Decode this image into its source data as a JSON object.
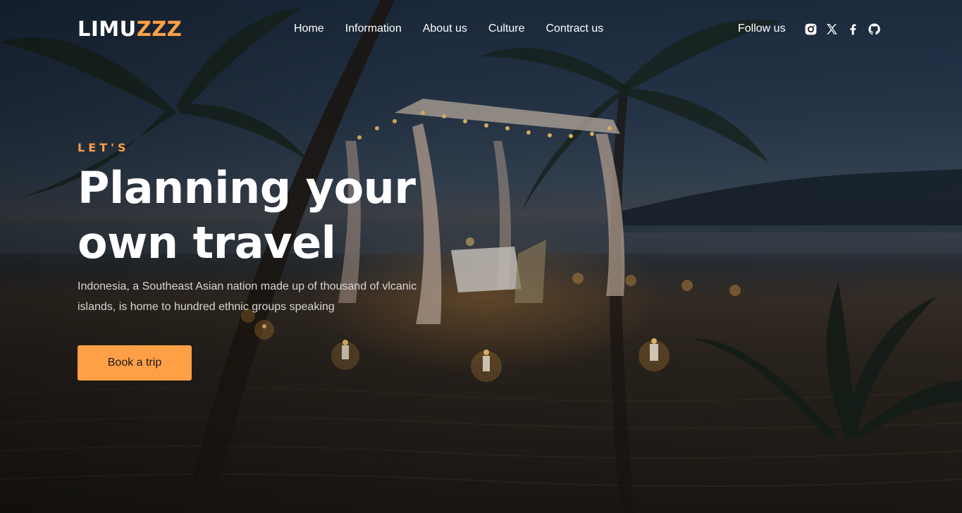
{
  "brand": {
    "logo_primary": "LIMU",
    "logo_accent": "ZZZ",
    "accent_color": "#ffa047"
  },
  "nav": {
    "items": [
      {
        "label": "Home"
      },
      {
        "label": "Information"
      },
      {
        "label": "About us"
      },
      {
        "label": "Culture"
      },
      {
        "label": "Contract us"
      }
    ]
  },
  "social": {
    "label": "Follow us",
    "icons": [
      "instagram-icon",
      "x-icon",
      "facebook-icon",
      "github-icon"
    ]
  },
  "hero": {
    "eyebrow": "LET'S",
    "headline_line1": "Planning your",
    "headline_line2": "own travel",
    "description": "Indonesia, a Southeast Asian nation made up of thousand of vlcanic islands, is home to hundred ethnic groups speaking",
    "cta_label": "Book a trip",
    "background": "night-beach-candlelit-canopy-image"
  }
}
